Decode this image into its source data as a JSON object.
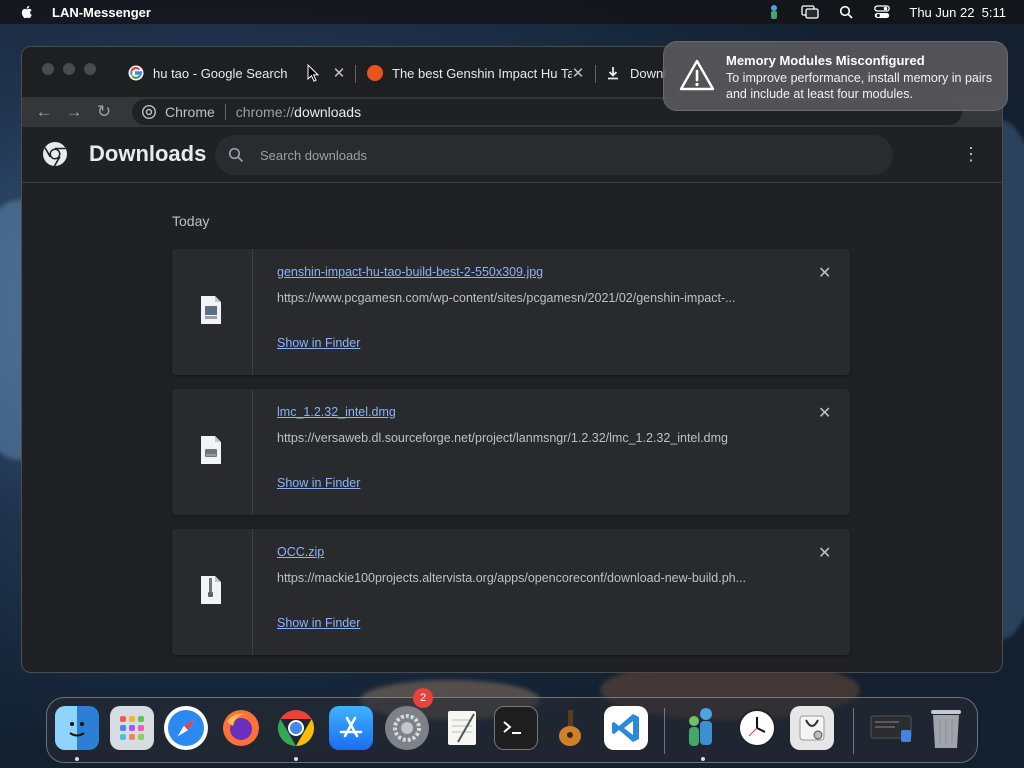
{
  "menubar": {
    "app_name": "LAN-Messenger",
    "datetime": "Thu Jun 22  5:11",
    "icons": [
      "apple-icon",
      "lan-messenger-status-icon",
      "screen-mirroring-icon",
      "spotlight-icon",
      "control-center-icon"
    ]
  },
  "tabs": [
    {
      "title": "hu tao - Google Search",
      "favicon": "google-icon"
    },
    {
      "title": "The best Genshin Impact Hu Tao",
      "favicon": "pcgamesn-icon"
    },
    {
      "title": "Downl",
      "favicon": "download-icon"
    }
  ],
  "omnibox": {
    "site": "Chrome",
    "url_scheme": "chrome://",
    "url_path": "downloads"
  },
  "downloads_page": {
    "title": "Downloads",
    "search_placeholder": "Search downloads",
    "section": "Today",
    "items": [
      {
        "filename": "genshin-impact-hu-tao-build-best-2-550x309.jpg",
        "url": "https://www.pcgamesn.com/wp-content/sites/pcgamesn/2021/02/genshin-impact-...",
        "action": "Show in Finder",
        "icon": "image-file-icon"
      },
      {
        "filename": "lmc_1.2.32_intel.dmg",
        "url": "https://versaweb.dl.sourceforge.net/project/lanmsngr/1.2.32/lmc_1.2.32_intel.dmg",
        "action": "Show in Finder",
        "icon": "disk-image-file-icon"
      },
      {
        "filename": "OCC.zip",
        "url": "https://mackie100projects.altervista.org/apps/opencoreconf/download-new-build.ph...",
        "action": "Show in Finder",
        "icon": "zip-file-icon"
      }
    ]
  },
  "notification": {
    "title": "Memory Modules Misconfigured",
    "body": "To improve performance, install memory in pairs and include at least four modules.",
    "icon": "warning-icon"
  },
  "dock": {
    "items": [
      "Finder",
      "Launchpad",
      "Safari",
      "Firefox",
      "Google Chrome",
      "App Store",
      "System Preferences",
      "TextEdit",
      "Terminal",
      "GarageBand",
      "Visual Studio Code",
      "LAN Messenger",
      "Clock",
      "Disk Utility",
      "Screenshot",
      "Trash"
    ],
    "system_prefs_badge": "2"
  },
  "colors": {
    "link": "#8ab4f8",
    "window_bg": "#202124",
    "card_bg": "#292a2d",
    "badge": "#e8423a"
  }
}
